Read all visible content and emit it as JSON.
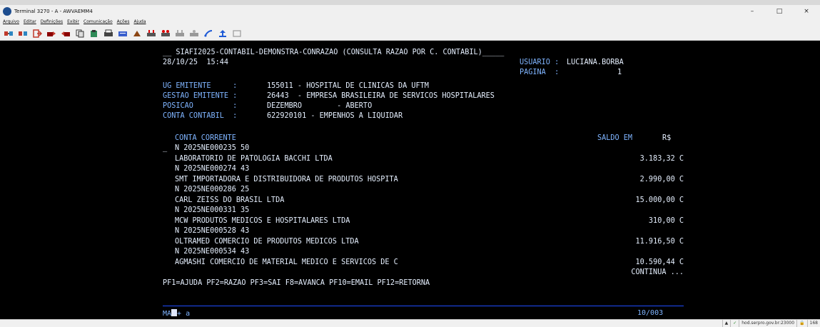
{
  "window": {
    "title": "Terminal 3270 - A - AWVAEMM4",
    "controls": [
      "–",
      "□",
      "×"
    ]
  },
  "menu": [
    "Arquivo",
    "Editar",
    "Definições",
    "Exibir",
    "Comunicação",
    "Ações",
    "Ajuda"
  ],
  "toolbar_icons": [
    "connect-icon",
    "disconnect-icon",
    "exit-icon",
    "send-icon",
    "receive-icon",
    "copy-icon",
    "paste-icon",
    "print-screen-icon",
    "keyboard-icon",
    "macro-icon",
    "transfer-icon",
    "run-icon",
    "stop-icon",
    "record-icon",
    "link-icon",
    "upload-icon",
    "display-icon"
  ],
  "terminal": {
    "header_left": "__ SIAFI2025-CONTABIL-DEMONSTRA-CONRAZAO (CONSULTA RAZAO POR C. CONTABIL)_____",
    "datetime": "28/10/25  15:44",
    "usuario_label": "USUARIO :",
    "usuario": "LUCIANA.BORBA",
    "pagina_label": "PAGINA  :",
    "pagina": "1",
    "fields": [
      {
        "label": "UG EMITENTE     :",
        "value": "155011 - HOSPITAL DE CLINICAS DA UFTM"
      },
      {
        "label": "GESTAO EMITENTE :",
        "value": "26443  - EMPRESA BRASILEIRA DE SERVICOS HOSPITALARES"
      },
      {
        "label": "POSICAO         :",
        "value": "DEZEMBRO        - ABERTO"
      },
      {
        "label": "CONTA CONTABIL  :",
        "value": "622920101 - EMPENHOS A LIQUIDAR"
      }
    ],
    "col_conta": "CONTA CORRENTE",
    "col_saldo": "SALDO EM",
    "col_moeda": "R$",
    "entries": [
      {
        "code": "N 2025NE000235 50",
        "name": "LABORATORIO DE PATOLOGIA BACCHI LTDA",
        "saldo": "3.183,32 C"
      },
      {
        "code": "N 2025NE000274 43",
        "name": "SMT IMPORTADORA E DISTRIBUIDORA DE PRODUTOS HOSPITA",
        "saldo": "2.990,00 C"
      },
      {
        "code": "N 2025NE000286 25",
        "name": "CARL ZEISS DO BRASIL LTDA",
        "saldo": "15.000,00 C"
      },
      {
        "code": "N 2025NE000331 35",
        "name": "MCW PRODUTOS MEDICOS E HOSPITALARES LTDA",
        "saldo": "310,00 C"
      },
      {
        "code": "N 2025NE000528 43",
        "name": "OLTRAMED COMERCIO DE PRODUTOS MEDICOS LTDA",
        "saldo": "11.916,50 C"
      },
      {
        "code": "N 2025NE000534 43",
        "name": "AGMASHI COMERCIO DE MATERIAL MEDICO E SERVICOS DE C",
        "saldo": "10.590,44 C"
      }
    ],
    "continua": "CONTINUA ...",
    "pf_keys": "PF1=AJUDA PF2=RAZAO PF3=SAI F8=AVANCA PF10=EMAIL PF12=RETORNA"
  },
  "status": {
    "mode": "MA",
    "indicator": "+   a",
    "position": "10/003"
  },
  "bottom": {
    "host": "hod.serpro.gov.br:23000",
    "port": "168"
  }
}
